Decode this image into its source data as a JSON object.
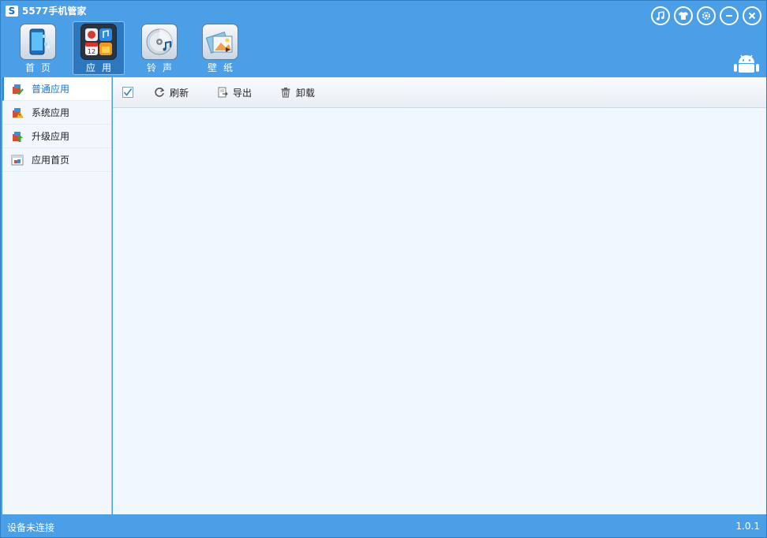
{
  "window": {
    "title": "5577手机管家",
    "logo_glyph": "S",
    "controls": [
      {
        "name": "music-icon"
      },
      {
        "name": "skin-icon"
      },
      {
        "name": "settings-icon"
      },
      {
        "name": "minimize-icon"
      },
      {
        "name": "close-icon"
      }
    ]
  },
  "nav": {
    "items": [
      {
        "label": "首页",
        "icon": "phone-icon",
        "active": false
      },
      {
        "label": "应用",
        "icon": "apps-icon",
        "active": true
      },
      {
        "label": "铃声",
        "icon": "cd-icon",
        "active": false
      },
      {
        "label": "壁纸",
        "icon": "wallpaper-icon",
        "active": false
      }
    ],
    "apps_icon_date": "12"
  },
  "sidebar": {
    "items": [
      {
        "label": "普通应用",
        "active": true
      },
      {
        "label": "系统应用",
        "active": false
      },
      {
        "label": "升级应用",
        "active": false
      },
      {
        "label": "应用首页",
        "active": false
      }
    ]
  },
  "toolbar": {
    "refresh_label": "刷新",
    "export_label": "导出",
    "uninstall_label": "卸载"
  },
  "status": {
    "connection": "设备未连接",
    "version": "1.0.1"
  },
  "colors": {
    "accent": "#4a9fe6",
    "nav_active": "#2d77bf",
    "panel": "#f0f7fe"
  }
}
